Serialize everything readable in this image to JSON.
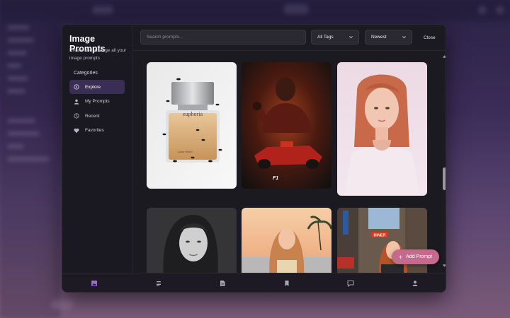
{
  "dialog": {
    "title": "Image Prompts",
    "subtitle": "Create and manage all your image prompts",
    "categories_label": "Categories",
    "nav": [
      {
        "label": "Explore",
        "icon": "compass-icon",
        "active": true
      },
      {
        "label": "My Prompts",
        "icon": "user-icon",
        "active": false
      },
      {
        "label": "Recent",
        "icon": "clock-icon",
        "active": false
      },
      {
        "label": "Favorites",
        "icon": "heart-icon",
        "active": false
      }
    ],
    "search": {
      "placeholder": "Search prompts...",
      "value": ""
    },
    "tag_filter": {
      "selected": "All Tags"
    },
    "sort": {
      "selected": "Newest"
    },
    "close_label": "Close",
    "add_prompt_label": "Add Prompt",
    "images": [
      {
        "subject": "perfume bottle with ants",
        "bottle_label": "euphoria",
        "brand": "Calvin Klein"
      },
      {
        "subject": "F1 driver poster",
        "logo": "F1"
      },
      {
        "subject": "portrait of red-haired woman"
      },
      {
        "subject": "black and white portrait"
      },
      {
        "subject": "woman on beach at sunset"
      },
      {
        "subject": "woman on city street",
        "sign": "DINER"
      }
    ],
    "bottom_nav": [
      "image-icon",
      "list-icon",
      "document-icon",
      "bookmark-icon",
      "chat-icon",
      "profile-icon"
    ]
  },
  "colors": {
    "accent": "#c46a8c",
    "active_nav": "#3a2e55",
    "modal_bg": "#1c1a21"
  }
}
